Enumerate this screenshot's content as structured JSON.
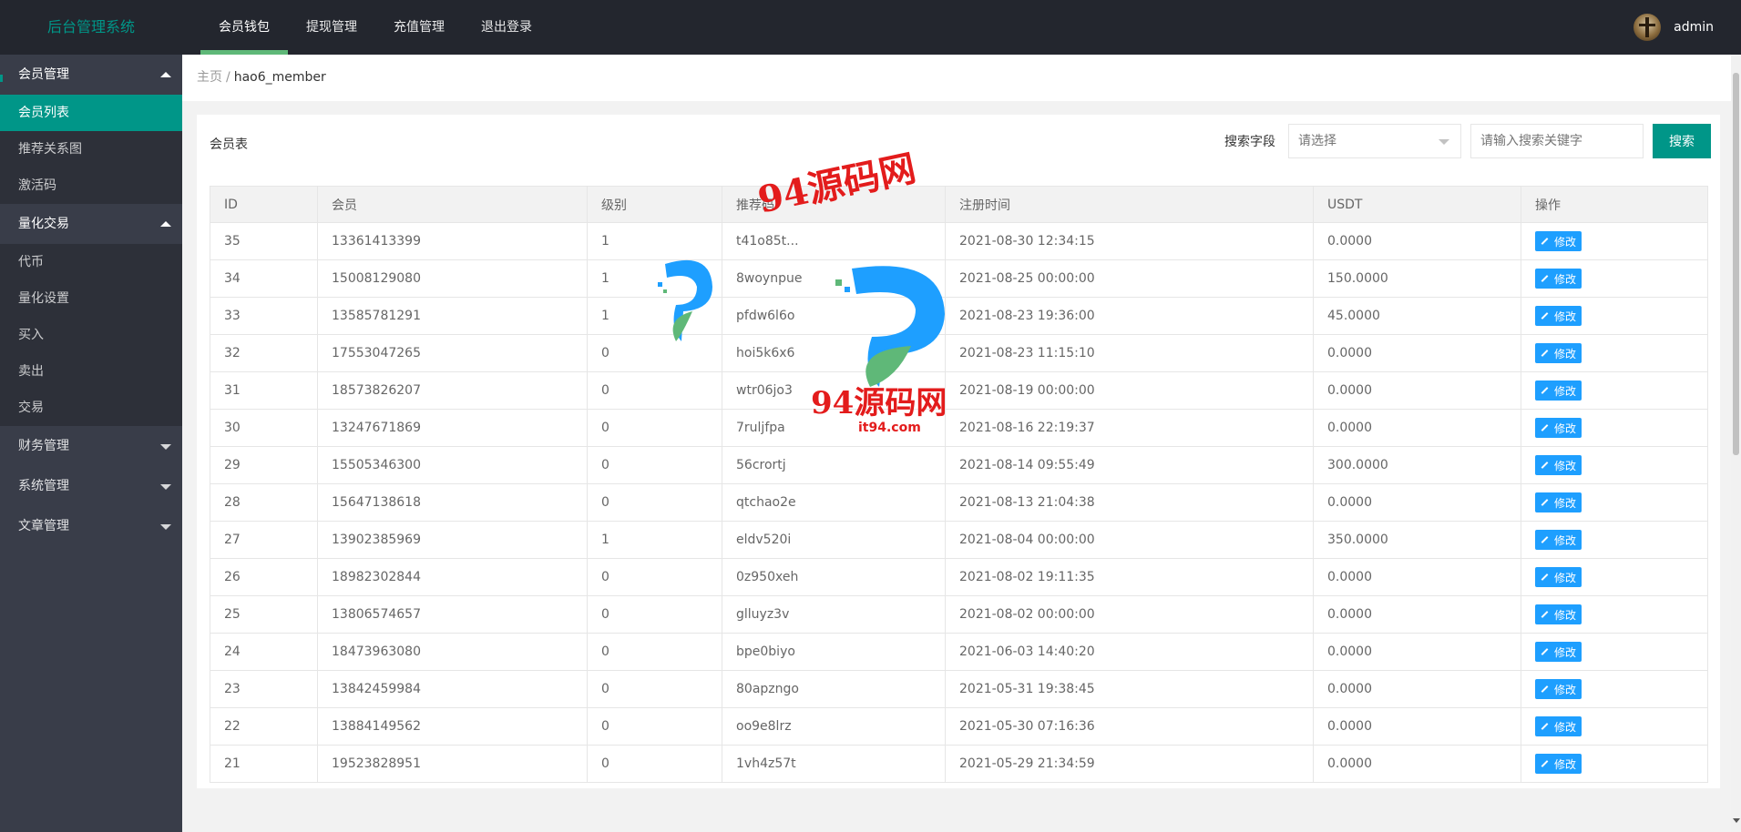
{
  "header": {
    "logo": "后台管理系统",
    "nav": [
      {
        "label": "会员钱包",
        "active": true
      },
      {
        "label": "提现管理",
        "active": false
      },
      {
        "label": "充值管理",
        "active": false
      },
      {
        "label": "退出登录",
        "active": false
      }
    ],
    "username": "admin"
  },
  "sidebar": {
    "groups": [
      {
        "label": "会员管理",
        "expanded": true,
        "items": [
          "会员列表",
          "推荐关系图",
          "激活码"
        ]
      },
      {
        "label": "量化交易",
        "expanded": true,
        "items": [
          "代币",
          "量化设置",
          "买入",
          "卖出",
          "交易"
        ]
      },
      {
        "label": "财务管理",
        "expanded": false,
        "items": []
      },
      {
        "label": "系统管理",
        "expanded": false,
        "items": []
      },
      {
        "label": "文章管理",
        "expanded": false,
        "items": []
      }
    ],
    "active_item": "会员列表"
  },
  "breadcrumb": {
    "home": "主页",
    "separator": "/",
    "current": "hao6_member"
  },
  "card": {
    "title": "会员表",
    "search_label": "搜索字段",
    "select_placeholder": "请选择",
    "input_placeholder": "请输入搜索关键字",
    "search_button": "搜索"
  },
  "table": {
    "columns": [
      "ID",
      "会员",
      "级别",
      "推荐码",
      "注册时间",
      "USDT",
      "操作"
    ],
    "edit_label": "修改",
    "rows": [
      [
        "35",
        "13361413399",
        "1",
        "t41o85t...",
        "2021-08-30 12:34:15",
        "0.0000"
      ],
      [
        "34",
        "15008129080",
        "1",
        "8woynpue",
        "2021-08-25 00:00:00",
        "150.0000"
      ],
      [
        "33",
        "13585781291",
        "1",
        "pfdw6l6o",
        "2021-08-23 19:36:00",
        "45.0000"
      ],
      [
        "32",
        "17553047265",
        "0",
        "hoi5k6x6",
        "2021-08-23 11:15:10",
        "0.0000"
      ],
      [
        "31",
        "18573826207",
        "0",
        "wtr06jo3",
        "2021-08-19 00:00:00",
        "0.0000"
      ],
      [
        "30",
        "13247671869",
        "0",
        "7ruljfpa",
        "2021-08-16 22:19:37",
        "0.0000"
      ],
      [
        "29",
        "15505346300",
        "0",
        "56crortj",
        "2021-08-14 09:55:49",
        "300.0000"
      ],
      [
        "28",
        "15647138618",
        "0",
        "qtchao2e",
        "2021-08-13 21:04:38",
        "0.0000"
      ],
      [
        "27",
        "13902385969",
        "1",
        "eldv520i",
        "2021-08-04 00:00:00",
        "350.0000"
      ],
      [
        "26",
        "18982302844",
        "0",
        "0z950xeh",
        "2021-08-02 19:11:35",
        "0.0000"
      ],
      [
        "25",
        "13806574657",
        "0",
        "glluyz3v",
        "2021-08-02 00:00:00",
        "0.0000"
      ],
      [
        "24",
        "18473963080",
        "0",
        "bpe0biyo",
        "2021-06-03 14:40:20",
        "0.0000"
      ],
      [
        "23",
        "13842459984",
        "0",
        "80apzngo",
        "2021-05-31 19:38:45",
        "0.0000"
      ],
      [
        "22",
        "13884149562",
        "0",
        "oo9e8lrz",
        "2021-05-30 07:16:36",
        "0.0000"
      ],
      [
        "21",
        "19523828951",
        "0",
        "1vh4z57t",
        "2021-05-29 21:34:59",
        "0.0000"
      ]
    ]
  },
  "watermark": {
    "text_main": "94源码网",
    "text_sub": "IT94.COM",
    "text_url": "it94.com"
  },
  "colors": {
    "header_bg": "#23262e",
    "sidebar_bg": "#393d49",
    "accent": "#009688",
    "edit_btn": "#1E9FFF",
    "watermark": "#e31c1c"
  }
}
